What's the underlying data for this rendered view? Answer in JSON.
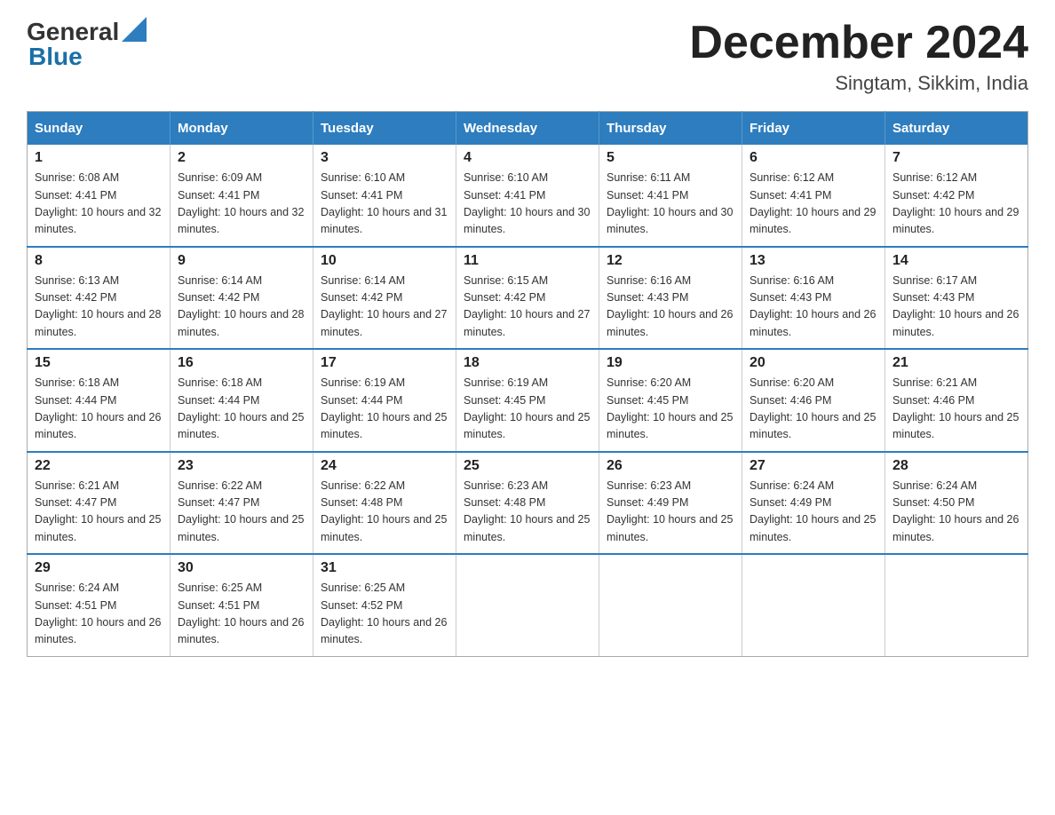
{
  "header": {
    "logo_general": "General",
    "logo_blue": "Blue",
    "month_title": "December 2024",
    "location": "Singtam, Sikkim, India"
  },
  "days_of_week": [
    "Sunday",
    "Monday",
    "Tuesday",
    "Wednesday",
    "Thursday",
    "Friday",
    "Saturday"
  ],
  "weeks": [
    [
      {
        "day": "1",
        "sunrise": "6:08 AM",
        "sunset": "4:41 PM",
        "daylight": "10 hours and 32 minutes."
      },
      {
        "day": "2",
        "sunrise": "6:09 AM",
        "sunset": "4:41 PM",
        "daylight": "10 hours and 32 minutes."
      },
      {
        "day": "3",
        "sunrise": "6:10 AM",
        "sunset": "4:41 PM",
        "daylight": "10 hours and 31 minutes."
      },
      {
        "day": "4",
        "sunrise": "6:10 AM",
        "sunset": "4:41 PM",
        "daylight": "10 hours and 30 minutes."
      },
      {
        "day": "5",
        "sunrise": "6:11 AM",
        "sunset": "4:41 PM",
        "daylight": "10 hours and 30 minutes."
      },
      {
        "day": "6",
        "sunrise": "6:12 AM",
        "sunset": "4:41 PM",
        "daylight": "10 hours and 29 minutes."
      },
      {
        "day": "7",
        "sunrise": "6:12 AM",
        "sunset": "4:42 PM",
        "daylight": "10 hours and 29 minutes."
      }
    ],
    [
      {
        "day": "8",
        "sunrise": "6:13 AM",
        "sunset": "4:42 PM",
        "daylight": "10 hours and 28 minutes."
      },
      {
        "day": "9",
        "sunrise": "6:14 AM",
        "sunset": "4:42 PM",
        "daylight": "10 hours and 28 minutes."
      },
      {
        "day": "10",
        "sunrise": "6:14 AM",
        "sunset": "4:42 PM",
        "daylight": "10 hours and 27 minutes."
      },
      {
        "day": "11",
        "sunrise": "6:15 AM",
        "sunset": "4:42 PM",
        "daylight": "10 hours and 27 minutes."
      },
      {
        "day": "12",
        "sunrise": "6:16 AM",
        "sunset": "4:43 PM",
        "daylight": "10 hours and 26 minutes."
      },
      {
        "day": "13",
        "sunrise": "6:16 AM",
        "sunset": "4:43 PM",
        "daylight": "10 hours and 26 minutes."
      },
      {
        "day": "14",
        "sunrise": "6:17 AM",
        "sunset": "4:43 PM",
        "daylight": "10 hours and 26 minutes."
      }
    ],
    [
      {
        "day": "15",
        "sunrise": "6:18 AM",
        "sunset": "4:44 PM",
        "daylight": "10 hours and 26 minutes."
      },
      {
        "day": "16",
        "sunrise": "6:18 AM",
        "sunset": "4:44 PM",
        "daylight": "10 hours and 25 minutes."
      },
      {
        "day": "17",
        "sunrise": "6:19 AM",
        "sunset": "4:44 PM",
        "daylight": "10 hours and 25 minutes."
      },
      {
        "day": "18",
        "sunrise": "6:19 AM",
        "sunset": "4:45 PM",
        "daylight": "10 hours and 25 minutes."
      },
      {
        "day": "19",
        "sunrise": "6:20 AM",
        "sunset": "4:45 PM",
        "daylight": "10 hours and 25 minutes."
      },
      {
        "day": "20",
        "sunrise": "6:20 AM",
        "sunset": "4:46 PM",
        "daylight": "10 hours and 25 minutes."
      },
      {
        "day": "21",
        "sunrise": "6:21 AM",
        "sunset": "4:46 PM",
        "daylight": "10 hours and 25 minutes."
      }
    ],
    [
      {
        "day": "22",
        "sunrise": "6:21 AM",
        "sunset": "4:47 PM",
        "daylight": "10 hours and 25 minutes."
      },
      {
        "day": "23",
        "sunrise": "6:22 AM",
        "sunset": "4:47 PM",
        "daylight": "10 hours and 25 minutes."
      },
      {
        "day": "24",
        "sunrise": "6:22 AM",
        "sunset": "4:48 PM",
        "daylight": "10 hours and 25 minutes."
      },
      {
        "day": "25",
        "sunrise": "6:23 AM",
        "sunset": "4:48 PM",
        "daylight": "10 hours and 25 minutes."
      },
      {
        "day": "26",
        "sunrise": "6:23 AM",
        "sunset": "4:49 PM",
        "daylight": "10 hours and 25 minutes."
      },
      {
        "day": "27",
        "sunrise": "6:24 AM",
        "sunset": "4:49 PM",
        "daylight": "10 hours and 25 minutes."
      },
      {
        "day": "28",
        "sunrise": "6:24 AM",
        "sunset": "4:50 PM",
        "daylight": "10 hours and 26 minutes."
      }
    ],
    [
      {
        "day": "29",
        "sunrise": "6:24 AM",
        "sunset": "4:51 PM",
        "daylight": "10 hours and 26 minutes."
      },
      {
        "day": "30",
        "sunrise": "6:25 AM",
        "sunset": "4:51 PM",
        "daylight": "10 hours and 26 minutes."
      },
      {
        "day": "31",
        "sunrise": "6:25 AM",
        "sunset": "4:52 PM",
        "daylight": "10 hours and 26 minutes."
      },
      null,
      null,
      null,
      null
    ]
  ],
  "labels": {
    "sunrise_prefix": "Sunrise: ",
    "sunset_prefix": "Sunset: ",
    "daylight_prefix": "Daylight: "
  }
}
